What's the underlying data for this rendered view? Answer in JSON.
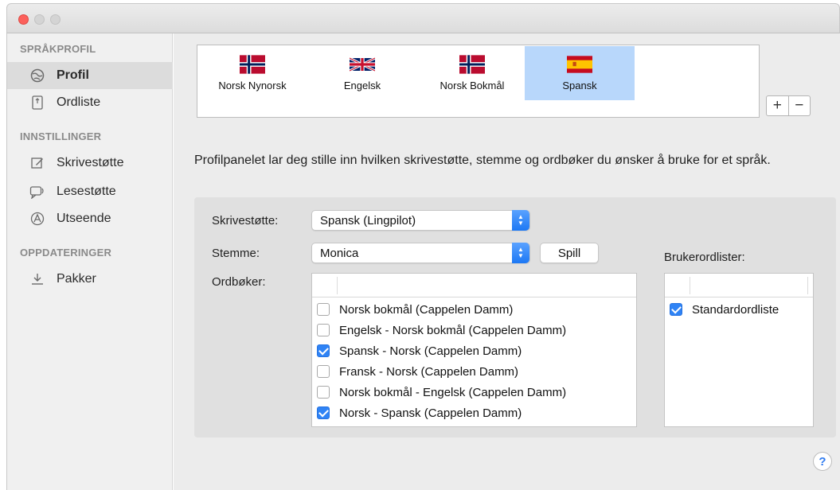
{
  "window": {
    "controls": [
      "close",
      "minimize",
      "zoom"
    ]
  },
  "sidebar": {
    "sections": [
      {
        "header": "SPRÅKPROFIL",
        "items": [
          {
            "label": "Profil",
            "icon": "globe-icon",
            "selected": true
          },
          {
            "label": "Ordliste",
            "icon": "book-icon",
            "selected": false
          }
        ]
      },
      {
        "header": "INNSTILLINGER",
        "items": [
          {
            "label": "Skrivestøtte",
            "icon": "pencil-icon",
            "selected": false
          },
          {
            "label": "Lesestøtte",
            "icon": "speech-icon",
            "selected": false
          },
          {
            "label": "Utseende",
            "icon": "appearance-icon",
            "selected": false
          }
        ]
      },
      {
        "header": "OPPDATERINGER",
        "items": [
          {
            "label": "Pakker",
            "icon": "download-icon",
            "selected": false
          }
        ]
      }
    ]
  },
  "languages": [
    {
      "label": "Norsk Nynorsk",
      "flag": "norway-flag",
      "selected": false
    },
    {
      "label": "Engelsk",
      "flag": "uk-flag",
      "selected": false
    },
    {
      "label": "Norsk Bokmål",
      "flag": "norway-flag",
      "selected": false
    },
    {
      "label": "Spansk",
      "flag": "spain-flag",
      "selected": true
    }
  ],
  "language_controls": {
    "add": "+",
    "remove": "−"
  },
  "description": "Profilpanelet lar deg stille inn hvilken skrivestøtte, stemme og ordbøker du ønsker å bruke for et språk.",
  "form": {
    "skrivestotte_label": "Skrivestøtte:",
    "skrivestotte_value": "Spansk (Lingpilot)",
    "stemme_label": "Stemme:",
    "stemme_value": "Monica",
    "play_button": "Spill",
    "ordboker_label": "Ordbøker:",
    "brukerordlister_label": "Brukerordlister:"
  },
  "dictionaries": [
    {
      "label": "Norsk bokmål (Cappelen Damm)",
      "checked": false
    },
    {
      "label": "Engelsk - Norsk bokmål (Cappelen Damm)",
      "checked": false
    },
    {
      "label": "Spansk - Norsk (Cappelen Damm)",
      "checked": true
    },
    {
      "label": "Fransk - Norsk (Cappelen Damm)",
      "checked": false
    },
    {
      "label": "Norsk bokmål - Engelsk (Cappelen Damm)",
      "checked": false
    },
    {
      "label": "Norsk - Spansk (Cappelen Damm)",
      "checked": true
    }
  ],
  "user_lists": [
    {
      "label": "Standardordliste",
      "checked": true
    }
  ],
  "help_label": "?",
  "colors": {
    "accent": "#2f83f5",
    "selection": "#b8d7fb",
    "close": "#fc605b"
  }
}
